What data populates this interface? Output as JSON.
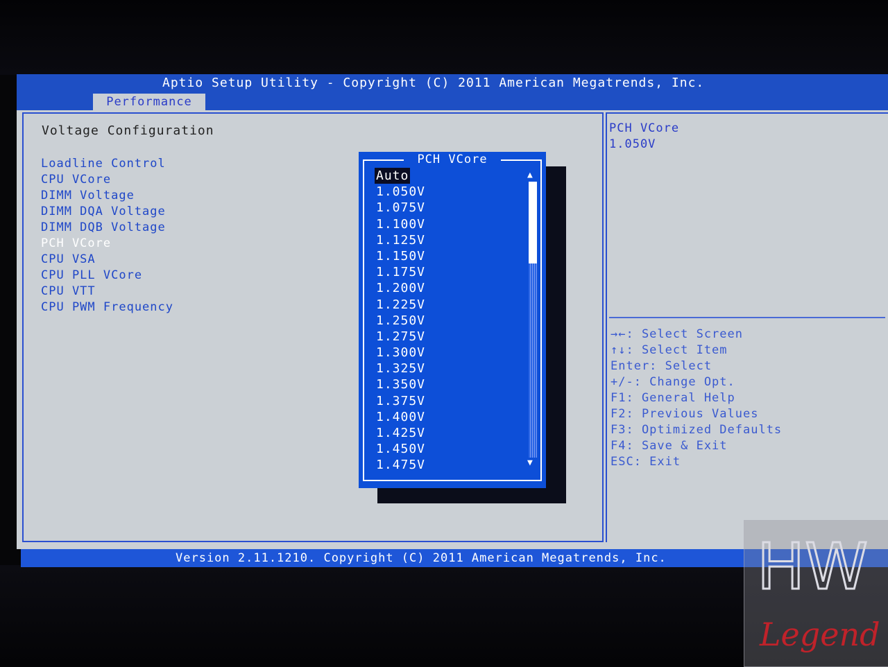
{
  "header": {
    "title": "Aptio Setup Utility - Copyright (C) 2011 American Megatrends, Inc.",
    "active_tab": "Performance"
  },
  "main": {
    "section_title": "Voltage Configuration",
    "items": [
      {
        "label": "Loadline Control"
      },
      {
        "label": "CPU VCore"
      },
      {
        "label": "DIMM Voltage"
      },
      {
        "label": "DIMM DQA Voltage"
      },
      {
        "label": "DIMM DQB Voltage"
      },
      {
        "label": "PCH VCore"
      },
      {
        "label": "CPU VSA"
      },
      {
        "label": "CPU PLL VCore"
      },
      {
        "label": "CPU VTT"
      },
      {
        "label": "CPU PWM Frequency"
      }
    ],
    "selected_index": 5
  },
  "popup": {
    "title": "PCH VCore",
    "options": [
      "Auto",
      "1.050V",
      "1.075V",
      "1.100V",
      "1.125V",
      "1.150V",
      "1.175V",
      "1.200V",
      "1.225V",
      "1.250V",
      "1.275V",
      "1.300V",
      "1.325V",
      "1.350V",
      "1.375V",
      "1.400V",
      "1.425V",
      "1.450V",
      "1.475V"
    ],
    "highlighted_index": 0
  },
  "help": {
    "title": "PCH VCore",
    "value": "1.050V",
    "keys": [
      "→←: Select Screen",
      "↑↓: Select Item",
      "Enter: Select",
      "+/-: Change Opt.",
      "F1: General Help",
      "F2: Previous Values",
      "F3: Optimized Defaults",
      "F4: Save & Exit",
      "ESC: Exit"
    ]
  },
  "footer": {
    "version": "Version 2.11.1210. Copyright (C) 2011 American Megatrends, Inc."
  },
  "watermark": {
    "line1": "HW",
    "line2": "Legend"
  },
  "colors": {
    "title_bar": "#1e4fc4",
    "background": "#cbd0d5",
    "menu_text": "#1f47c8",
    "popup_bg": "#0d4fd8",
    "status_bar": "#1e56d8"
  }
}
